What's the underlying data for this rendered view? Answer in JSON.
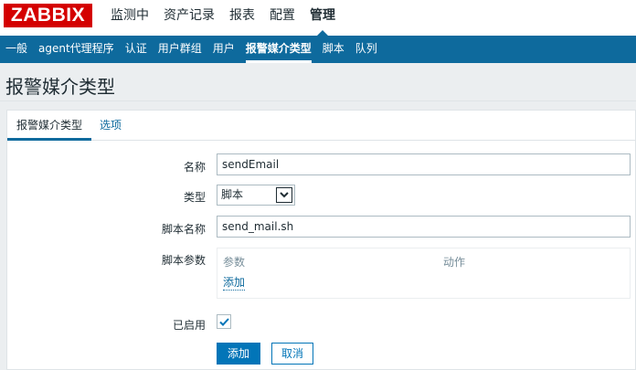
{
  "logo": "ZABBIX",
  "topmenu": [
    {
      "label": "监测中"
    },
    {
      "label": "资产记录"
    },
    {
      "label": "报表"
    },
    {
      "label": "配置"
    },
    {
      "label": "管理"
    }
  ],
  "subnav": [
    {
      "label": "一般"
    },
    {
      "label": "agent代理程序"
    },
    {
      "label": "认证"
    },
    {
      "label": "用户群组"
    },
    {
      "label": "用户"
    },
    {
      "label": "报警媒介类型"
    },
    {
      "label": "脚本"
    },
    {
      "label": "队列"
    }
  ],
  "page_title": "报警媒介类型",
  "tabs": {
    "media_type": "报警媒介类型",
    "options": "选项"
  },
  "form": {
    "name_label": "名称",
    "name_value": "sendEmail",
    "type_label": "类型",
    "type_value": "脚本",
    "script_label": "脚本名称",
    "script_value": "send_mail.sh",
    "params_label": "脚本参数",
    "params_col_param": "参数",
    "params_col_action": "动作",
    "params_add": "添加",
    "enabled_label": "已启用",
    "enabled_checked": true,
    "add_button": "添加",
    "cancel_button": "取消"
  },
  "colors": {
    "brand": "#d40000",
    "nav": "#0e6a9d",
    "button": "#0275b8"
  }
}
